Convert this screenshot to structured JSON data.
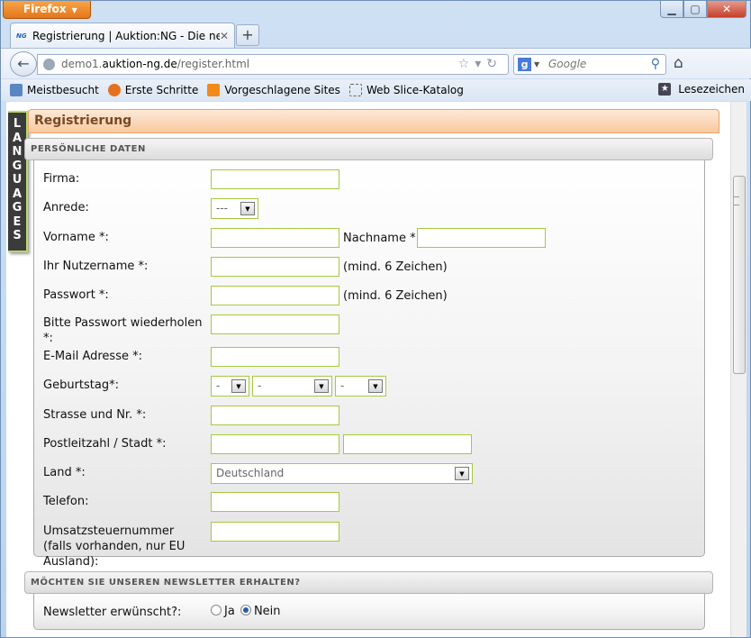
{
  "browser": {
    "app_button": "Firefox",
    "window_controls": {
      "minimize": "▭",
      "restore": "▫",
      "close": "✕"
    },
    "tab_title": "Registrierung | Auktion:NG - Die neue G...",
    "tab_favicon": "NG",
    "url_prefix": "demo1.",
    "url_domain": "auktion-ng.de",
    "url_path": "/register.html",
    "search_placeholder": "Google",
    "bookmarks": [
      "Meistbesucht",
      "Erste Schritte",
      "Vorgeschlagene Sites",
      "Web Slice-Katalog"
    ],
    "bookmarks_right": "Lesezeichen"
  },
  "page": {
    "languages_tab": [
      "L",
      "A",
      "N",
      "G",
      "U",
      "A",
      "G",
      "E",
      "S"
    ],
    "title": "Registrierung",
    "section_personal": "PERSÖNLICHE DATEN",
    "section_newsletter": "MÖCHTEN SIE UNSEREN NEWSLETTER ERHALTEN?",
    "labels": {
      "firma": "Firma:",
      "anrede": "Anrede:",
      "vorname": "Vorname *:",
      "nachname": "Nachname *",
      "nutzername": "Ihr Nutzername *:",
      "passwort": "Passwort *:",
      "passwort2": "Bitte Passwort wiederholen *:",
      "email": "E-Mail Adresse *:",
      "geburtstag": "Geburtstag*:",
      "strasse": "Strasse und Nr. *:",
      "plz": "Postleitzahl / Stadt *:",
      "land": "Land *:",
      "telefon": "Telefon:",
      "ust": "Umsatzsteuernummer (falls vorhanden, nur EU Ausland):",
      "newsletter": "Newsletter erwünscht?:"
    },
    "hints": {
      "min6": "(mind. 6 Zeichen)"
    },
    "selects": {
      "anrede": "---",
      "day": "-",
      "month": "-",
      "year": "-",
      "land": "Deutschland"
    },
    "newsletter_options": {
      "yes": "Ja",
      "no": "Nein",
      "selected": "Nein"
    }
  },
  "colors": {
    "accent_orange": "#f8c9a0",
    "input_border": "#a6c93f"
  }
}
